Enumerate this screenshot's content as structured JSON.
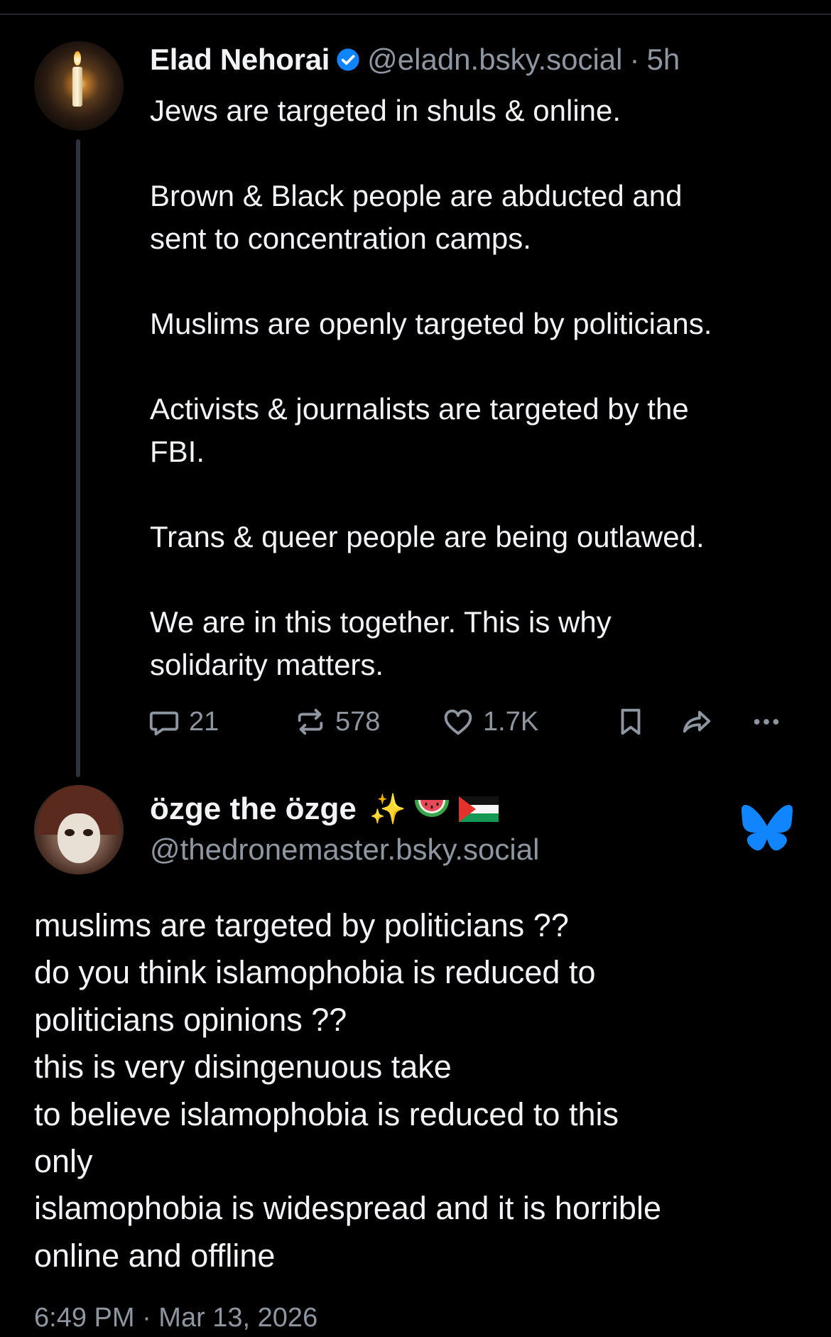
{
  "parent_post": {
    "author_name": "Elad Nehorai",
    "handle": "@eladn.bsky.social",
    "separator": "·",
    "time": "5h",
    "body": [
      "Jews are targeted in shuls & online.",
      "",
      "Brown & Black people are abducted and",
      "sent to concentration camps.",
      "",
      "Muslims are openly targeted by politicians.",
      "",
      "Activists & journalists are targeted by the",
      "FBI.",
      "",
      "Trans & queer people are being outlawed.",
      "",
      "We are in this together. This is why",
      "solidarity matters."
    ],
    "stats": {
      "replies": "21",
      "reposts": "578",
      "likes": "1.7K"
    },
    "icons": [
      "verified-icon",
      "reply-icon",
      "repost-icon",
      "like-icon",
      "bookmark-icon",
      "share-icon",
      "more-icon"
    ]
  },
  "reply_post": {
    "author_name": "özge the özge",
    "name_emoji": [
      "sparkles",
      "watermelon",
      "palestine-flag"
    ],
    "sparkles_glyph": "✨",
    "handle": "@thedronemaster.bsky.social",
    "body": [
      "muslims are targeted by politicians ??",
      "do you think islamophobia is reduced to",
      "politicians opinions ??",
      "this is very disingenuous take",
      "to believe islamophobia is reduced to this",
      "only",
      "islamophobia is widespread and it is horrible",
      "online and offline"
    ],
    "timestamp": "6:49 PM · Mar 13, 2026",
    "icons": [
      "bluesky-butterfly-icon"
    ]
  },
  "colors": {
    "background": "#000000",
    "primary_text": "#f1f3f5",
    "secondary_text": "#8d96a1",
    "verified_blue": "#1083fe",
    "bluesky_blue": "#1185fe",
    "thread_line": "#2d333b"
  }
}
